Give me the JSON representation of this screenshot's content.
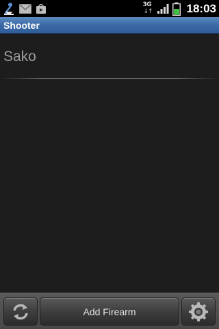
{
  "status_bar": {
    "network_type": "3G",
    "clock": "18:03",
    "icons": [
      "usb-debug-icon",
      "gmail-icon",
      "play-store-icon",
      "signal-icon",
      "battery-icon"
    ]
  },
  "title_bar": {
    "title": "Shooter"
  },
  "list": {
    "items": [
      {
        "label": "Sako"
      }
    ]
  },
  "bottom_bar": {
    "add_button_label": "Add Firearm",
    "refresh_icon": "refresh-icon",
    "settings_icon": "settings-icon"
  },
  "colors": {
    "title_bar": "#3b6aa7",
    "background": "#1d1d1d",
    "battery_fill": "#3fbf3f"
  }
}
